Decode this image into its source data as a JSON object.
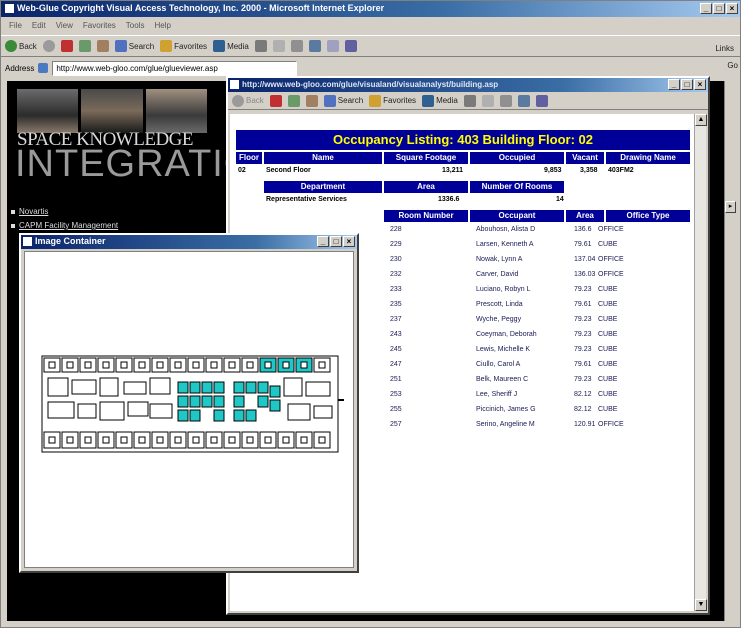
{
  "ie": {
    "title": "Web-Glue Copyright Visual Access Technology, Inc. 2000 - Microsoft Internet Explorer",
    "menu": [
      "File",
      "Edit",
      "View",
      "Favorites",
      "Tools",
      "Help"
    ],
    "toolbar": {
      "back": "Back",
      "search": "Search",
      "favorites": "Favorites",
      "media": "Media"
    },
    "address_label": "Address",
    "address_value": "http://www.web-gloo.com/glue/glueviewer.asp",
    "links_label": "Links",
    "go_label": "Go"
  },
  "site": {
    "logo_top": "SPACE KNOWLEDGE",
    "logo_bottom": "INTEGRATION",
    "nav": [
      "Novartis",
      "CAPM Facility Management"
    ]
  },
  "image_window": {
    "title": "Image Container"
  },
  "occupancy_window": {
    "title": "http://www.web-gloo.com/glue/visualand/visualanalyst/building.asp",
    "toolbar": {
      "back": "Back",
      "search": "Search",
      "favorites": "Favorites",
      "media": "Media"
    }
  },
  "listing": {
    "title": "Occupancy Listing: 403 Building Floor: 02",
    "floor_headers": [
      "Floor",
      "Name",
      "Square Footage",
      "Occupied",
      "Vacant",
      "Drawing Name"
    ],
    "floor_row": [
      "02",
      "Second Floor",
      "13,211",
      "9,853",
      "3,358",
      "403FM2"
    ],
    "dept_headers": [
      "Department",
      "Area",
      "Number Of Rooms"
    ],
    "dept_row": [
      "Representative Services",
      "1336.6",
      "14"
    ],
    "room_headers": [
      "Room Number",
      "Occupant",
      "Area",
      "Office Type"
    ],
    "rooms": [
      [
        "228",
        "Abouhosn, Alista D",
        "136.6",
        "OFFICE"
      ],
      [
        "229",
        "Larsen, Kenneth A",
        "79.61",
        "CUBE"
      ],
      [
        "230",
        "Nowak, Lynn A",
        "137.04",
        "OFFICE"
      ],
      [
        "232",
        "Carver, David",
        "136.03",
        "OFFICE"
      ],
      [
        "233",
        "Luciano, Robyn L",
        "79.23",
        "CUBE"
      ],
      [
        "235",
        "Prescott, Linda",
        "79.61",
        "CUBE"
      ],
      [
        "237",
        "Wyche, Peggy",
        "79.23",
        "CUBE"
      ],
      [
        "243",
        "Coeyman, Deborah",
        "79.23",
        "CUBE"
      ],
      [
        "245",
        "Lewis, Michelle K",
        "79.23",
        "CUBE"
      ],
      [
        "247",
        "Ciullo, Carol A",
        "79.61",
        "CUBE"
      ],
      [
        "251",
        "Belk, Maureen C",
        "79.23",
        "CUBE"
      ],
      [
        "253",
        "Lee, Sheriff J",
        "82.12",
        "CUBE"
      ],
      [
        "255",
        "Piccinich, James G",
        "82.12",
        "CUBE"
      ],
      [
        "257",
        "Serino, Angeline M",
        "120.91",
        "OFFICE"
      ]
    ]
  },
  "colors": {
    "header_bg": "#000099",
    "title_text": "#ffff00",
    "highlight": "#1fc7c7"
  }
}
